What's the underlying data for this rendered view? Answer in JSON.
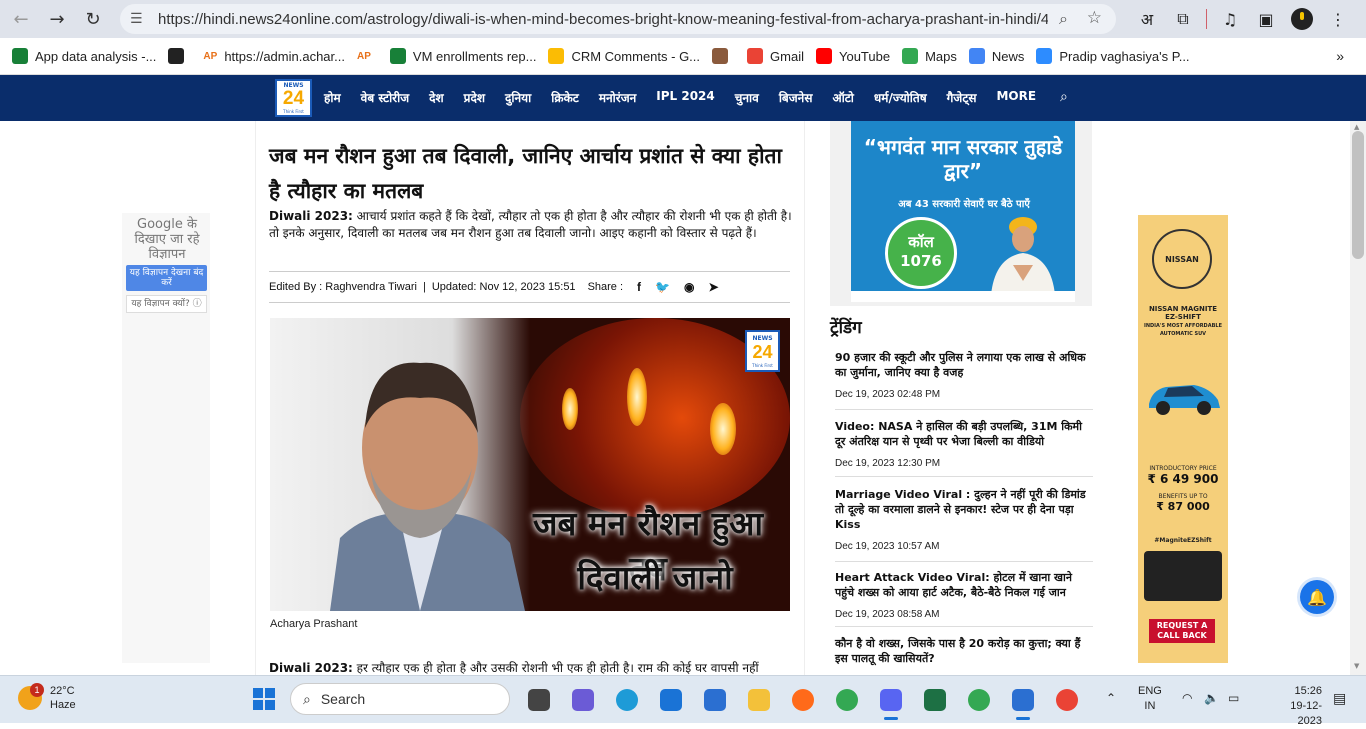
{
  "browser": {
    "url": "https://hindi.news24online.com/astrology/diwali-is-when-mind-becomes-bright-know-meaning-festival-from-acharya-prashant-in-hindi/4376...",
    "toolbar_icons": [
      "translate-icon",
      "extensions-icon",
      "media-icon",
      "sidebar-icon",
      "profile-icon",
      "menu-icon"
    ],
    "translate_label": "अ"
  },
  "bookmarks": [
    {
      "label": "App data analysis -...",
      "icon": "sheets-icon",
      "color": "#188038"
    },
    {
      "label": "",
      "icon": "globe-icon",
      "color": "#222222"
    },
    {
      "label": "https://admin.achar...",
      "icon": "ap-icon",
      "color": "#e8711a",
      "badge": "AP"
    },
    {
      "label": "",
      "icon": "ap-icon",
      "color": "#e8711a",
      "badge": "AP"
    },
    {
      "label": "VM enrollments rep...",
      "icon": "sheets-icon",
      "color": "#188038"
    },
    {
      "label": "CRM Comments - G...",
      "icon": "drive-icon",
      "color": "#fbbc04"
    },
    {
      "label": "",
      "icon": "avatar-icon",
      "color": "#8a5a3c"
    },
    {
      "label": "Gmail",
      "icon": "gmail-icon",
      "color": "#ea4335"
    },
    {
      "label": "YouTube",
      "icon": "youtube-icon",
      "color": "#ff0000"
    },
    {
      "label": "Maps",
      "icon": "maps-icon",
      "color": "#34a853"
    },
    {
      "label": "News",
      "icon": "news-icon",
      "color": "#4285f4"
    },
    {
      "label": "Pradip vaghasiya's P...",
      "icon": "zoom-icon",
      "color": "#2d8cff"
    }
  ],
  "site_nav": {
    "logo": {
      "top": "NEWS",
      "num": "24",
      "tag": "Think First"
    },
    "items": [
      "होम",
      "वेब स्टोरीज",
      "देश",
      "प्रदेश",
      "दुनिया",
      "क्रिकेट",
      "मनोरंजन",
      "IPL 2024",
      "चुनाव",
      "बिजनेस",
      "ऑटो",
      "धर्म/ज्योतिष",
      "गैजेट्स",
      "MORE"
    ]
  },
  "left_ad": {
    "heading": "Google के दिखाए जा रहे विज्ञापन",
    "stop_button": "यह विज्ञापन देखना बंद करें",
    "why": "यह विज्ञापन क्यों? ⓘ"
  },
  "article": {
    "title": "जब मन रौशन हुआ तब दिवाली, जानिए आर्चाय प्रशांत से क्या होता है त्यौहार का मतलब",
    "desc_lead": "Diwali 2023:",
    "desc_text": " आचार्य प्रशांत कहते हैं कि देखों, त्यौहार तो एक ही होता है और त्यौहार की रोशनी भी एक ही होती है। तो इनके अनुसार, दिवाली का मतलब जब मन रौशन हुआ तब दिवाली जानो। आइए कहानी को विस्तार से पढ़ते हैं।",
    "edited_by": "Edited By : Raghvendra Tiwari",
    "updated": "Updated: Nov 12, 2023 15:51",
    "share_label": "Share :",
    "image_text_line1": "जब मन रौशन हुआ तब",
    "image_text_line2": "दिवाली जानो",
    "caption": "Acharya Prashant",
    "para_lead": "Diwali 2023:",
    "para_text": " हर त्यौहार एक ही होता है और उसकी रोशनी भी एक ही होती है। राम की कोई घर वापसी नहीं"
  },
  "right_ad": {
    "headline": "“भगवंत मान सरकार तुहाडे द्वार”",
    "sub": "अब 43 सरकारी सेवाएँ घर बैठे पाएँ",
    "call1": "कॉल",
    "call2": "1076"
  },
  "trending": {
    "heading": "ट्रेंडिंग",
    "items": [
      {
        "title": "90 हजार की स्कूटी और पुलिस ने लगाया एक लाख से अधिक का जुर्माना, जानिए क्या है वजह",
        "date": "Dec 19, 2023 02:48 PM"
      },
      {
        "title": "Video: NASA ने हासिल की बड़ी उपलब्धि, 31M किमी दूर अंतरिक्ष यान से पृथ्वी पर भेजा बिल्ली का वीडियो",
        "date": "Dec 19, 2023 12:30 PM"
      },
      {
        "title": "Marriage Video Viral : दुल्हन ने नहीं पूरी की डिमांड तो दूल्हे का वरमाला डालने से इनकार! स्टेज पर ही देना पड़ा Kiss",
        "date": "Dec 19, 2023 10:57 AM"
      },
      {
        "title": "Heart Attack Video Viral: होटल में खाना खाने पहुंचे शख्स को आया हार्ट अटैक, बैठे-बैठे निकल गई जान",
        "date": "Dec 19, 2023 08:58 AM"
      },
      {
        "title": "कौन है वो शख्स, जिसके पास है 20 करोड़ का कुत्ता; क्या हैं इस पालतू की खासियतें?",
        "date": ""
      }
    ]
  },
  "nissan_ad": {
    "brand": "NISSAN",
    "model": "NISSAN MAGNITE EZ-SHIFT",
    "tagline": "INDIA'S MOST AFFORDABLE AUTOMATIC SUV",
    "price_label": "INTRODUCTORY PRICE",
    "price": "₹ 6 49 900",
    "benefit_label": "BENEFITS UP TO",
    "benefit": "₹ 87 000",
    "hashtag": "#MagniteEZShift",
    "cta": "REQUEST A CALL BACK"
  },
  "taskbar": {
    "weather_temp": "22°C",
    "weather_desc": "Haze",
    "weather_badge": "1",
    "search_placeholder": "Search",
    "lang1": "ENG",
    "lang2": "IN",
    "time": "15:26",
    "date": "19-12-2023"
  },
  "colors": {
    "nav_bg": "#0a2d6b",
    "accent": "#1a73e8",
    "ad_blue": "#1d86c9"
  }
}
